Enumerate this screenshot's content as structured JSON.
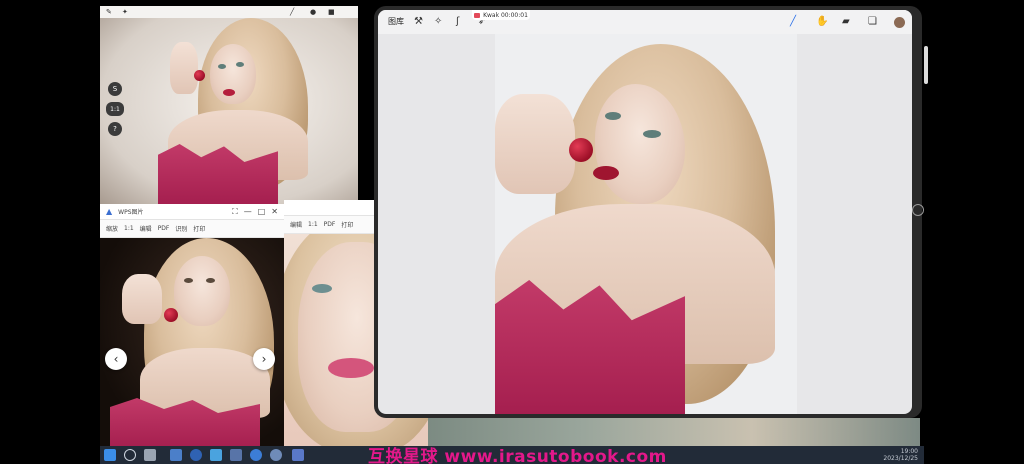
{
  "main_window": {
    "gallery_label": "图库",
    "recording_text": "Kwak 00:00:01",
    "tools": {
      "actions": "wrench-icon",
      "adjust": "magic-wand-icon",
      "select": "select-s-icon",
      "transform": "arrow-icon",
      "brush": "brush-icon",
      "smudge": "smudge-icon",
      "eraser": "eraser-icon",
      "layers": "layers-icon"
    },
    "color_swatch": "#8b6a54"
  },
  "mini_window": {
    "side_buttons": [
      "S",
      "1:1",
      "?"
    ]
  },
  "photo_viewer": {
    "title": "WPS图片",
    "toolbar": [
      "缩放",
      "1:1",
      "编辑",
      "PDF",
      "识别",
      "打印"
    ],
    "toolbar_right": [
      "编辑",
      "1:1",
      "PDF",
      "打印"
    ],
    "prev": "‹",
    "next": "›"
  },
  "taskbar": {
    "clock_time": "19:00",
    "clock_date": "2023/12/25"
  },
  "watermark": "互换星球 www.irasutobook.com",
  "colors": {
    "dress": "#a51f4f",
    "watermark": "#e3188a",
    "taskbar": "#222b38"
  }
}
